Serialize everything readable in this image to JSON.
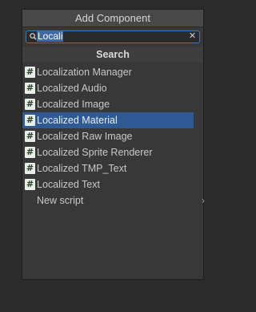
{
  "popup": {
    "title": "Add Component"
  },
  "search": {
    "value": "Locali"
  },
  "section": {
    "title": "Search"
  },
  "items": [
    {
      "label": "Localization Manager",
      "icon": "hash-icon"
    },
    {
      "label": "Localized Audio",
      "icon": "hash-icon"
    },
    {
      "label": "Localized Image",
      "icon": "hash-icon"
    },
    {
      "label": "Localized Material",
      "icon": "hash-icon",
      "selected": true
    },
    {
      "label": "Localized Raw Image",
      "icon": "hash-icon"
    },
    {
      "label": "Localized Sprite Renderer",
      "icon": "hash-icon"
    },
    {
      "label": "Localized TMP_Text",
      "icon": "hash-icon"
    },
    {
      "label": "Localized Text",
      "icon": "hash-icon"
    }
  ],
  "new_script": {
    "label": "New script",
    "icon": "chevron-right-icon"
  },
  "colors": {
    "selection": "#2f5a94",
    "search_border": "#3a79bb"
  }
}
